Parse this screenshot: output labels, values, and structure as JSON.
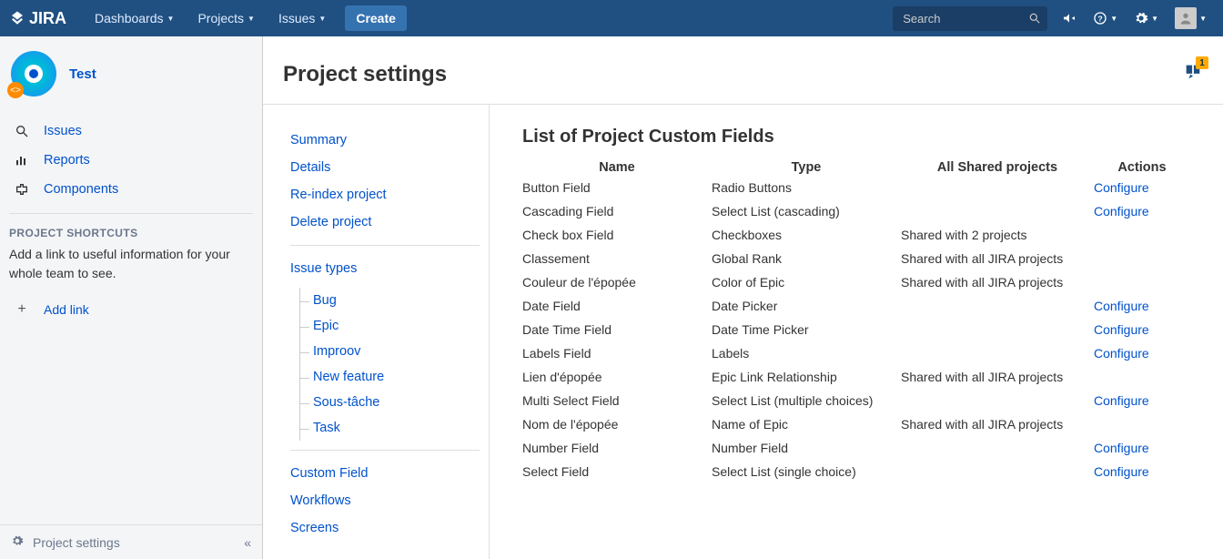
{
  "nav": {
    "logo": "JIRA",
    "dashboards": "Dashboards",
    "projects": "Projects",
    "issues": "Issues",
    "create": "Create",
    "search_placeholder": "Search"
  },
  "sidebar": {
    "project_name": "Test",
    "items": [
      {
        "label": "Issues"
      },
      {
        "label": "Reports"
      },
      {
        "label": "Components"
      }
    ],
    "shortcuts_heading": "PROJECT SHORTCUTS",
    "shortcuts_desc": "Add a link to useful information for your whole team to see.",
    "add_link": "Add link",
    "footer_label": "Project settings"
  },
  "content": {
    "title": "Project settings",
    "table_title": "List of Project Custom Fields"
  },
  "settings_nav": {
    "summary": "Summary",
    "details": "Details",
    "reindex": "Re-index project",
    "delete": "Delete project",
    "issue_types": "Issue types",
    "types": [
      "Bug",
      "Epic",
      "Improov",
      "New feature",
      "Sous-tâche",
      "Task"
    ],
    "custom_field": "Custom Field",
    "workflows": "Workflows",
    "screens": "Screens"
  },
  "table": {
    "headers": {
      "name": "Name",
      "type": "Type",
      "shared": "All Shared projects",
      "actions": "Actions"
    },
    "configure": "Configure",
    "rows": [
      {
        "name": "Button Field",
        "type": "Radio Buttons",
        "shared": "",
        "action": true
      },
      {
        "name": "Cascading Field",
        "type": "Select List (cascading)",
        "shared": "",
        "action": true
      },
      {
        "name": "Check box Field",
        "type": "Checkboxes",
        "shared": "Shared with 2 projects",
        "action": false
      },
      {
        "name": "Classement",
        "type": "Global Rank",
        "shared": "Shared with all JIRA projects",
        "action": false
      },
      {
        "name": "Couleur de l'épopée",
        "type": "Color of Epic",
        "shared": "Shared with all JIRA projects",
        "action": false
      },
      {
        "name": "Date Field",
        "type": "Date Picker",
        "shared": "",
        "action": true
      },
      {
        "name": "Date Time Field",
        "type": "Date Time Picker",
        "shared": "",
        "action": true
      },
      {
        "name": "Labels Field",
        "type": "Labels",
        "shared": "",
        "action": true
      },
      {
        "name": "Lien d'épopée",
        "type": "Epic Link Relationship",
        "shared": "Shared with all JIRA projects",
        "action": false
      },
      {
        "name": "Multi Select Field",
        "type": "Select List (multiple choices)",
        "shared": "",
        "action": true
      },
      {
        "name": "Nom de l'épopée",
        "type": "Name of Epic",
        "shared": "Shared with all JIRA projects",
        "action": false
      },
      {
        "name": "Number Field",
        "type": "Number Field",
        "shared": "",
        "action": true
      },
      {
        "name": "Select Field",
        "type": "Select List (single choice)",
        "shared": "",
        "action": true
      }
    ]
  }
}
